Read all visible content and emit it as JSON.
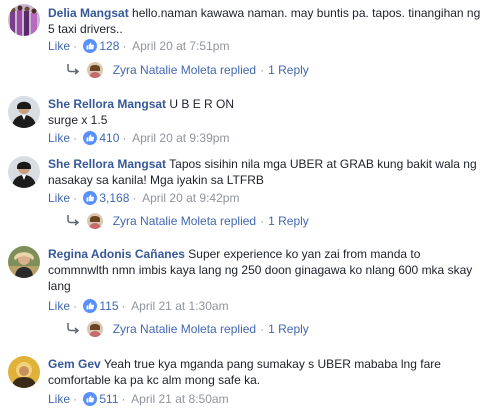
{
  "comments": [
    {
      "author": "Delia Mangsat",
      "text": "hello.naman kawawa naman. may buntis pa. tapos. tinangihan ng 5 taxi drivers..",
      "like_label": "Like",
      "reactions": "128",
      "timestamp": "April 20 at 7:51pm",
      "reply": {
        "name": "Zyra Natalie Moleta replied",
        "count": "1 Reply"
      }
    },
    {
      "author": "She Rellora Mangsat",
      "text": "U B E R ON",
      "text2": "surge x 1.5",
      "like_label": "Like",
      "reactions": "410",
      "timestamp": "April 20 at 9:39pm"
    },
    {
      "author": "She Rellora Mangsat",
      "text": "Tapos sisihin nila mga UBER at GRAB kung bakit wala ng nasakay sa kanila! Mga iyakin sa LTFRB",
      "like_label": "Like",
      "reactions": "3,168",
      "timestamp": "April 20 at 9:42pm",
      "reply": {
        "name": "Zyra Natalie Moleta replied",
        "count": "1 Reply"
      }
    },
    {
      "author": "Regina Adonis Cañanes",
      "text": "Super experience ko yan zai from manda to commnwlth nmn imbis kaya lang ng 250 doon ginagawa ko nlang 600 mka skay lang",
      "like_label": "Like",
      "reactions": "115",
      "timestamp": "April 21 at 1:30am",
      "reply": {
        "name": "Zyra Natalie Moleta replied",
        "count": "1 Reply"
      }
    },
    {
      "author": "Gem Gev",
      "text": "Yeah true kya mganda pang sumakay s UBER mababa lng fare comfortable ka pa kc alm mong safe ka.",
      "like_label": "Like",
      "reactions": "511",
      "timestamp": "April 21 at 8:50am"
    }
  ],
  "colors": {
    "author": "#365899",
    "link": "#4267b2",
    "meta": "#90949c",
    "text": "#1d2129",
    "like_badge": "#5890ff"
  },
  "icons": [
    "like-reaction-icon",
    "reply-arrow-icon"
  ]
}
